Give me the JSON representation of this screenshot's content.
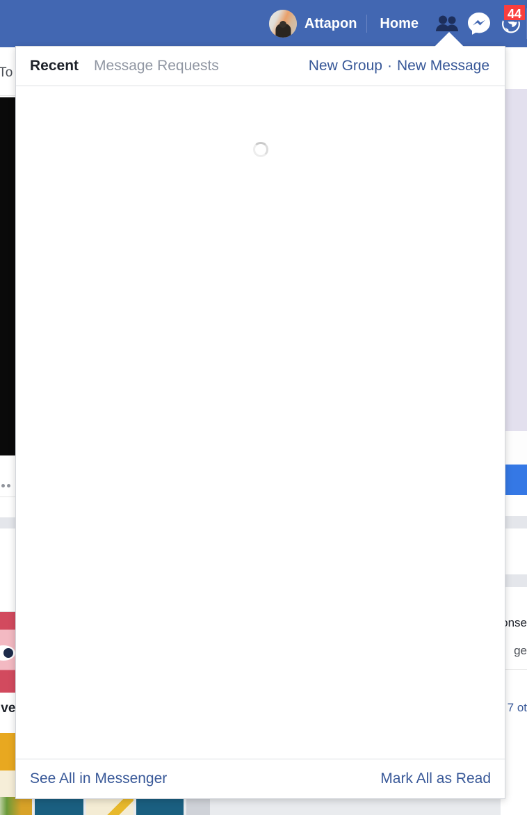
{
  "topbar": {
    "background_color": "#4267b2",
    "profile": {
      "name": "Attapon",
      "avatar_icon": "user-avatar-photo"
    },
    "home_label": "Home",
    "icons": [
      {
        "name": "friend-requests-icon",
        "label": "Friend Requests"
      },
      {
        "name": "messenger-icon",
        "label": "Messenger",
        "active": true
      },
      {
        "name": "notifications-globe-icon",
        "label": "Notifications",
        "badge": "44",
        "badge_color": "#fa3e3e"
      }
    ]
  },
  "dropdown": {
    "tabs": [
      {
        "id": "recent",
        "label": "Recent",
        "active": true
      },
      {
        "id": "message-requests",
        "label": "Message Requests",
        "active": false
      }
    ],
    "actions": {
      "new_group": "New Group",
      "separator": "·",
      "new_message": "New Message"
    },
    "body": {
      "state": "loading",
      "spinner_icon": "loading-spinner-icon"
    },
    "footer": {
      "see_all": "See All in Messenger",
      "mark_all_read": "Mark All as Read"
    },
    "link_color": "#385898"
  },
  "background": {
    "left": {
      "top_text": "To",
      "caption_text": "ive",
      "dots_icon": "more-options-dots-icon",
      "eye_icon": "eye-graphic-icon"
    },
    "right": {
      "text_fragment_1": "onse",
      "text_fragment_2": "ge",
      "text_fragment_3": "7 ot",
      "button_color": "#3578e5"
    }
  }
}
